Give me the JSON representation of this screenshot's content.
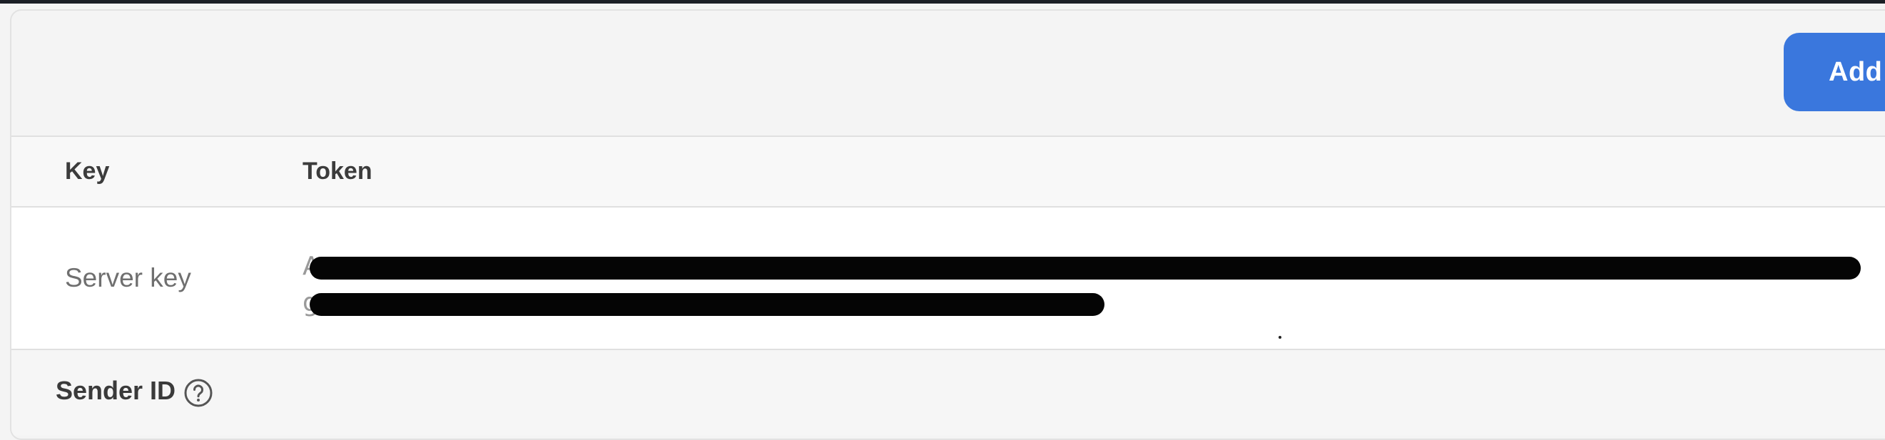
{
  "toolbar": {
    "add_label": "Add",
    "accent_color": "#3a77dd"
  },
  "table": {
    "columns": [
      "Key",
      "Token"
    ],
    "rows": [
      {
        "key": "Server key",
        "token_line1": "A",
        "token_line2": "g",
        "token_redacted": true
      }
    ]
  },
  "sender": {
    "label": "Sender ID",
    "help_icon": "question-circle-icon"
  }
}
